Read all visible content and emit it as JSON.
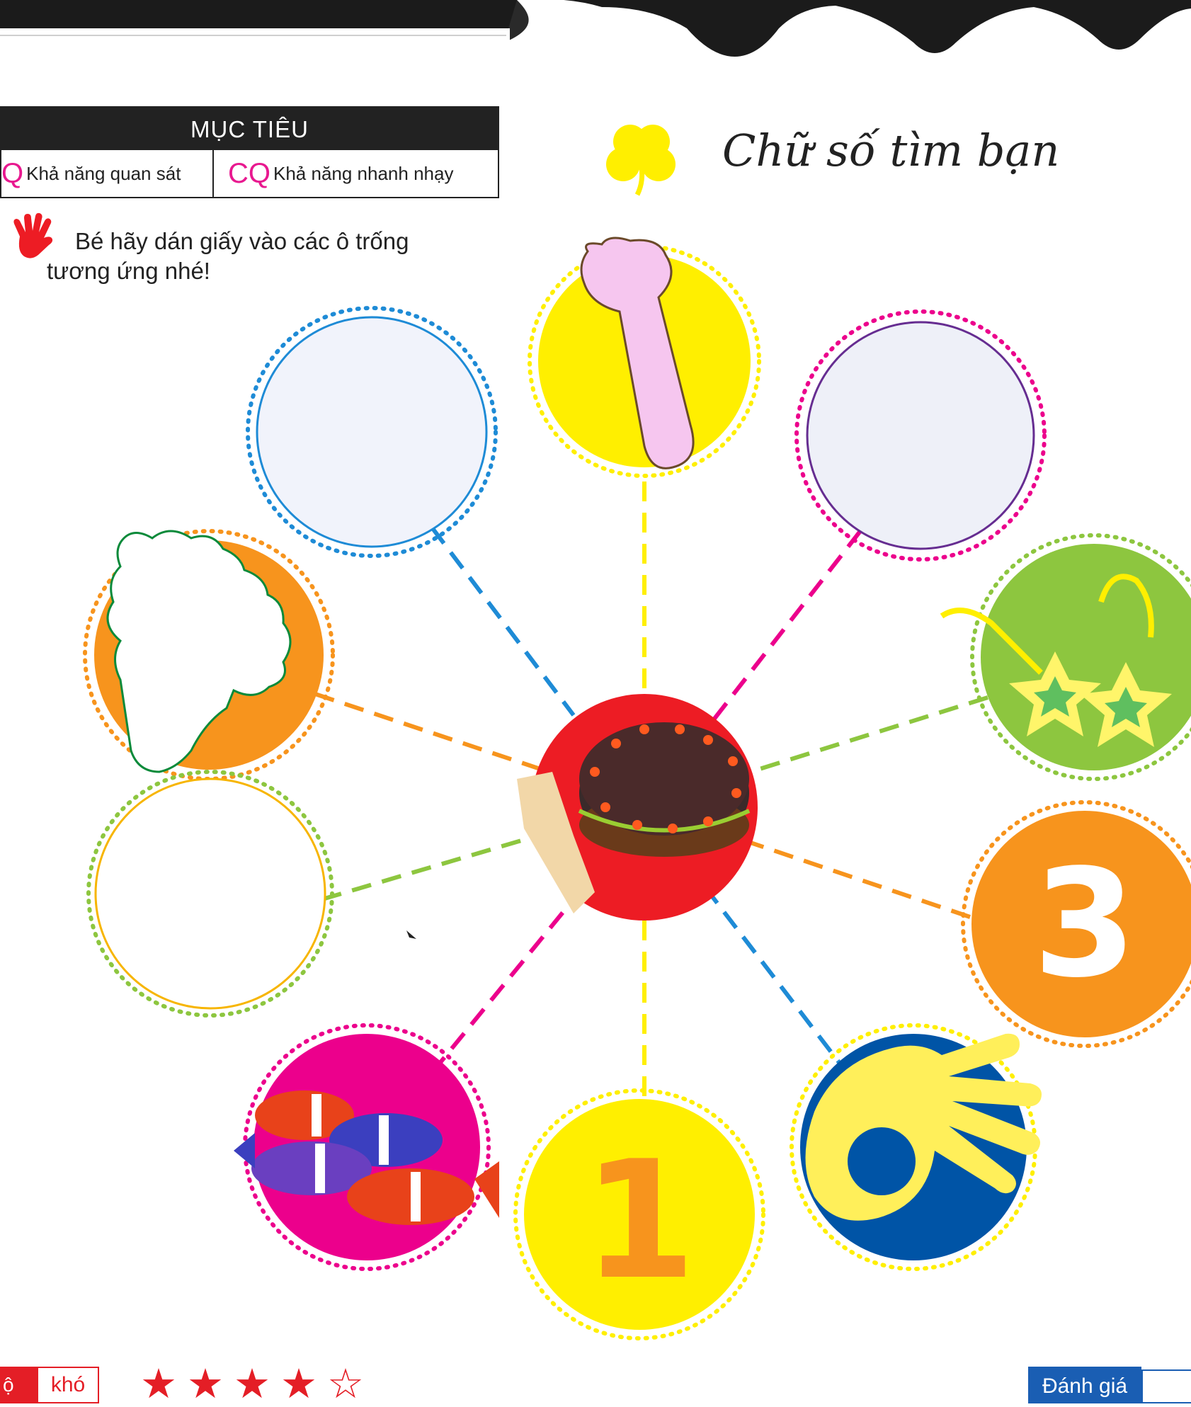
{
  "objectives": {
    "heading": "MỤC TIÊU",
    "items": [
      {
        "code": "Q",
        "label": "Khả năng quan sát"
      },
      {
        "code": "CQ",
        "label": "Khả năng nhanh nhạy"
      }
    ]
  },
  "title": "Chữ số tìm bạn",
  "instruction": {
    "line1": "Bé hãy dán giấy vào các ô trống",
    "line2": "tương ứng nhé!"
  },
  "circles": {
    "number_3": "3",
    "number_1": "1"
  },
  "colors": {
    "yellow": "#ffef00",
    "orange": "#f7941d",
    "green": "#8dc63f",
    "pink": "#ec008c",
    "blue": "#0054a6",
    "red": "#ed1c24",
    "light_blue": "#29a8e0",
    "purple": "#662d91"
  },
  "difficulty": {
    "tab": "ộ",
    "label": "khó",
    "rating": 4,
    "max": 5,
    "filled_star": "★",
    "empty_star": "☆"
  },
  "evaluation": {
    "label": "Đánh giá"
  }
}
